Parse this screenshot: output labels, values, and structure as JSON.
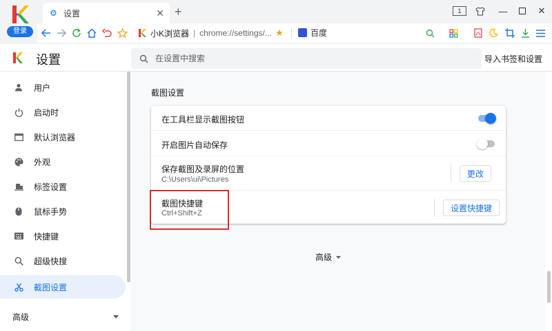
{
  "browser": {
    "login_label": "登录",
    "tab_title": "设置",
    "tab_count": "1",
    "omnibox": {
      "site_name": "小K浏览器",
      "separator": "|",
      "url": "chrome://settings/..."
    },
    "bookmark": "百度"
  },
  "settings": {
    "title": "设置",
    "search_placeholder": "在设置中搜索",
    "import_link": "导入书签和设置"
  },
  "sidebar": {
    "items": [
      {
        "label": "用户",
        "icon": "person-icon"
      },
      {
        "label": "启动时",
        "icon": "power-icon"
      },
      {
        "label": "默认浏览器",
        "icon": "browser-icon"
      },
      {
        "label": "外观",
        "icon": "palette-icon"
      },
      {
        "label": "标签设置",
        "icon": "tab-icon"
      },
      {
        "label": "鼠标手势",
        "icon": "mouse-icon"
      },
      {
        "label": "快捷键",
        "icon": "keyboard-icon"
      },
      {
        "label": "超级快搜",
        "icon": "search-icon"
      },
      {
        "label": "截图设置",
        "icon": "scissors-icon"
      }
    ],
    "active_index": 8,
    "advanced": "高级"
  },
  "main": {
    "section_title": "截图设置",
    "rows": {
      "toolbar_button": {
        "label": "在工具栏显示截图按钮",
        "enabled": true
      },
      "auto_save": {
        "label": "开启图片自动保存",
        "enabled": false
      },
      "save_location": {
        "label": "保存截图及录屏的位置",
        "value": "C:\\Users\\ui\\Pictures",
        "button": "更改"
      },
      "shortcut": {
        "label": "截图快捷键",
        "value": "Ctrl+Shift+Z",
        "button": "设置快捷键"
      }
    },
    "advanced": "高级"
  },
  "colors": {
    "accent": "#1a73e8",
    "highlight": "#d32f2f",
    "active_bg": "#e8f0fe"
  }
}
